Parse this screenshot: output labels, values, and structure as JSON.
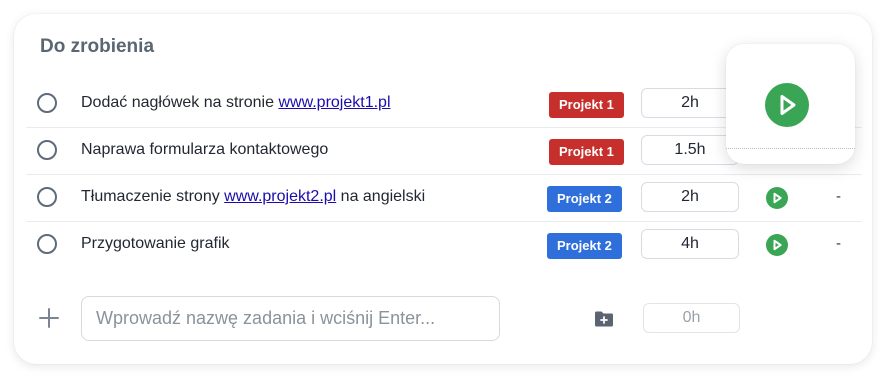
{
  "title": "Do zrobienia",
  "tasks": [
    {
      "text_before": "Dodać nagłówek na stronie ",
      "link": "www.projekt1.pl",
      "text_after": "",
      "project": "Projekt 1",
      "time": "2h",
      "extra": ""
    },
    {
      "text_before": "Naprawa formularza kontaktowego",
      "link": "",
      "text_after": "",
      "project": "Projekt 1",
      "time": "1.5h",
      "extra": ""
    },
    {
      "text_before": "Tłumaczenie strony ",
      "link": "www.projekt2.pl",
      "text_after": " na angielski",
      "project": "Projekt 2",
      "time": "2h",
      "extra": "-"
    },
    {
      "text_before": "Przygotowanie grafik",
      "link": "",
      "text_after": "",
      "project": "Projekt 2",
      "time": "4h",
      "extra": "-"
    }
  ],
  "new_task": {
    "placeholder": "Wprowadź nazwę zadania i wciśnij Enter...",
    "time": "0h"
  },
  "colors": {
    "project1": "#c62f2b",
    "project2": "#2f6fdc",
    "play": "#3aa655"
  },
  "icons": {
    "checkbox": "circle-checkbox-icon",
    "play": "play-icon",
    "add": "plus-icon",
    "folder": "folder-add-icon"
  }
}
